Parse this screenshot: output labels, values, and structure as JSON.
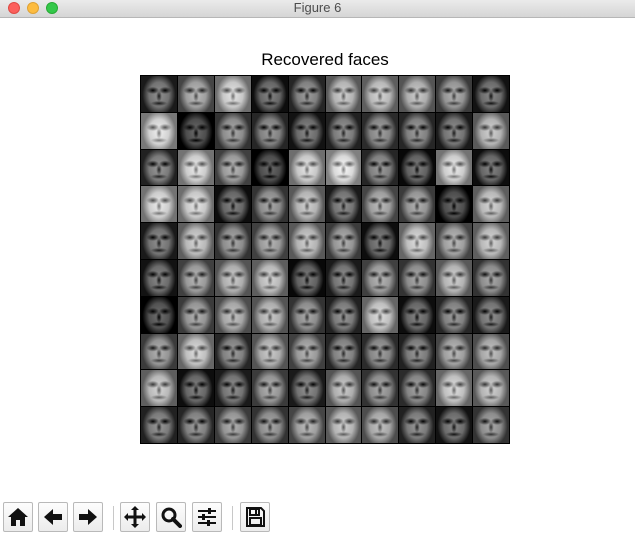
{
  "window": {
    "title": "Figure 6"
  },
  "figure": {
    "title": "Recovered faces",
    "rows": 10,
    "cols": 10
  },
  "toolbar": {
    "buttons": [
      {
        "name": "home-button",
        "icon": "home-icon"
      },
      {
        "name": "back-button",
        "icon": "arrow-left-icon"
      },
      {
        "name": "forward-button",
        "icon": "arrow-right-icon"
      },
      {
        "name": "pan-button",
        "icon": "move-icon"
      },
      {
        "name": "zoom-button",
        "icon": "magnifier-icon"
      },
      {
        "name": "configure-subplots-button",
        "icon": "sliders-icon"
      },
      {
        "name": "save-button",
        "icon": "floppy-disk-icon"
      }
    ]
  },
  "colors": {
    "tile_tones": [
      [
        0.45,
        0.62,
        0.78,
        0.4,
        0.5,
        0.7,
        0.72,
        0.68,
        0.58,
        0.42
      ],
      [
        0.82,
        0.3,
        0.55,
        0.5,
        0.42,
        0.48,
        0.52,
        0.5,
        0.45,
        0.7
      ],
      [
        0.48,
        0.8,
        0.6,
        0.3,
        0.78,
        0.85,
        0.5,
        0.38,
        0.8,
        0.4
      ],
      [
        0.8,
        0.78,
        0.4,
        0.55,
        0.7,
        0.45,
        0.62,
        0.58,
        0.3,
        0.72
      ],
      [
        0.45,
        0.72,
        0.55,
        0.6,
        0.7,
        0.58,
        0.4,
        0.75,
        0.62,
        0.72
      ],
      [
        0.42,
        0.6,
        0.68,
        0.72,
        0.38,
        0.45,
        0.6,
        0.55,
        0.7,
        0.55
      ],
      [
        0.32,
        0.58,
        0.65,
        0.68,
        0.55,
        0.48,
        0.75,
        0.4,
        0.5,
        0.45
      ],
      [
        0.58,
        0.75,
        0.5,
        0.68,
        0.6,
        0.5,
        0.52,
        0.48,
        0.62,
        0.65
      ],
      [
        0.72,
        0.4,
        0.45,
        0.58,
        0.45,
        0.68,
        0.55,
        0.52,
        0.75,
        0.7
      ],
      [
        0.48,
        0.5,
        0.58,
        0.55,
        0.62,
        0.7,
        0.65,
        0.48,
        0.42,
        0.55
      ]
    ]
  }
}
